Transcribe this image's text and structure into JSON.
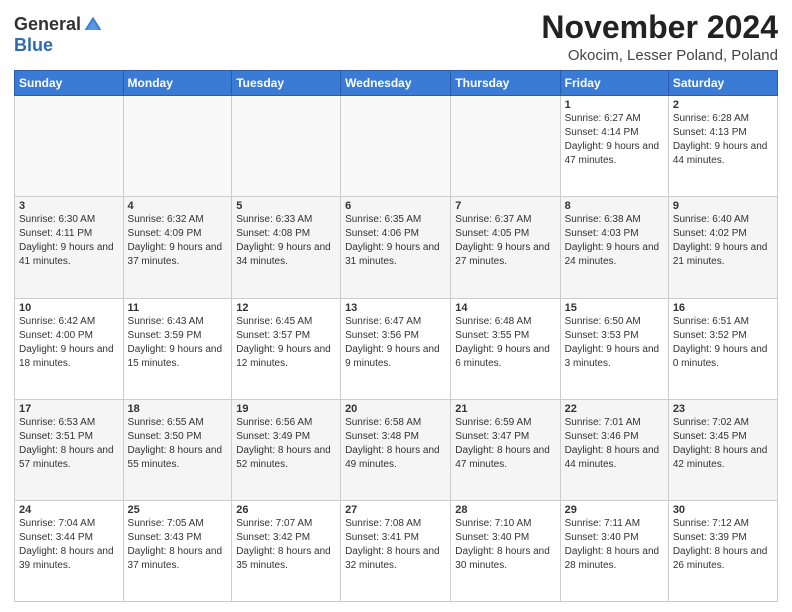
{
  "header": {
    "logo_general": "General",
    "logo_blue": "Blue",
    "month_title": "November 2024",
    "location": "Okocim, Lesser Poland, Poland"
  },
  "days_of_week": [
    "Sunday",
    "Monday",
    "Tuesday",
    "Wednesday",
    "Thursday",
    "Friday",
    "Saturday"
  ],
  "weeks": [
    [
      {
        "day": "",
        "info": ""
      },
      {
        "day": "",
        "info": ""
      },
      {
        "day": "",
        "info": ""
      },
      {
        "day": "",
        "info": ""
      },
      {
        "day": "",
        "info": ""
      },
      {
        "day": "1",
        "info": "Sunrise: 6:27 AM\nSunset: 4:14 PM\nDaylight: 9 hours and 47 minutes."
      },
      {
        "day": "2",
        "info": "Sunrise: 6:28 AM\nSunset: 4:13 PM\nDaylight: 9 hours and 44 minutes."
      }
    ],
    [
      {
        "day": "3",
        "info": "Sunrise: 6:30 AM\nSunset: 4:11 PM\nDaylight: 9 hours and 41 minutes."
      },
      {
        "day": "4",
        "info": "Sunrise: 6:32 AM\nSunset: 4:09 PM\nDaylight: 9 hours and 37 minutes."
      },
      {
        "day": "5",
        "info": "Sunrise: 6:33 AM\nSunset: 4:08 PM\nDaylight: 9 hours and 34 minutes."
      },
      {
        "day": "6",
        "info": "Sunrise: 6:35 AM\nSunset: 4:06 PM\nDaylight: 9 hours and 31 minutes."
      },
      {
        "day": "7",
        "info": "Sunrise: 6:37 AM\nSunset: 4:05 PM\nDaylight: 9 hours and 27 minutes."
      },
      {
        "day": "8",
        "info": "Sunrise: 6:38 AM\nSunset: 4:03 PM\nDaylight: 9 hours and 24 minutes."
      },
      {
        "day": "9",
        "info": "Sunrise: 6:40 AM\nSunset: 4:02 PM\nDaylight: 9 hours and 21 minutes."
      }
    ],
    [
      {
        "day": "10",
        "info": "Sunrise: 6:42 AM\nSunset: 4:00 PM\nDaylight: 9 hours and 18 minutes."
      },
      {
        "day": "11",
        "info": "Sunrise: 6:43 AM\nSunset: 3:59 PM\nDaylight: 9 hours and 15 minutes."
      },
      {
        "day": "12",
        "info": "Sunrise: 6:45 AM\nSunset: 3:57 PM\nDaylight: 9 hours and 12 minutes."
      },
      {
        "day": "13",
        "info": "Sunrise: 6:47 AM\nSunset: 3:56 PM\nDaylight: 9 hours and 9 minutes."
      },
      {
        "day": "14",
        "info": "Sunrise: 6:48 AM\nSunset: 3:55 PM\nDaylight: 9 hours and 6 minutes."
      },
      {
        "day": "15",
        "info": "Sunrise: 6:50 AM\nSunset: 3:53 PM\nDaylight: 9 hours and 3 minutes."
      },
      {
        "day": "16",
        "info": "Sunrise: 6:51 AM\nSunset: 3:52 PM\nDaylight: 9 hours and 0 minutes."
      }
    ],
    [
      {
        "day": "17",
        "info": "Sunrise: 6:53 AM\nSunset: 3:51 PM\nDaylight: 8 hours and 57 minutes."
      },
      {
        "day": "18",
        "info": "Sunrise: 6:55 AM\nSunset: 3:50 PM\nDaylight: 8 hours and 55 minutes."
      },
      {
        "day": "19",
        "info": "Sunrise: 6:56 AM\nSunset: 3:49 PM\nDaylight: 8 hours and 52 minutes."
      },
      {
        "day": "20",
        "info": "Sunrise: 6:58 AM\nSunset: 3:48 PM\nDaylight: 8 hours and 49 minutes."
      },
      {
        "day": "21",
        "info": "Sunrise: 6:59 AM\nSunset: 3:47 PM\nDaylight: 8 hours and 47 minutes."
      },
      {
        "day": "22",
        "info": "Sunrise: 7:01 AM\nSunset: 3:46 PM\nDaylight: 8 hours and 44 minutes."
      },
      {
        "day": "23",
        "info": "Sunrise: 7:02 AM\nSunset: 3:45 PM\nDaylight: 8 hours and 42 minutes."
      }
    ],
    [
      {
        "day": "24",
        "info": "Sunrise: 7:04 AM\nSunset: 3:44 PM\nDaylight: 8 hours and 39 minutes."
      },
      {
        "day": "25",
        "info": "Sunrise: 7:05 AM\nSunset: 3:43 PM\nDaylight: 8 hours and 37 minutes."
      },
      {
        "day": "26",
        "info": "Sunrise: 7:07 AM\nSunset: 3:42 PM\nDaylight: 8 hours and 35 minutes."
      },
      {
        "day": "27",
        "info": "Sunrise: 7:08 AM\nSunset: 3:41 PM\nDaylight: 8 hours and 32 minutes."
      },
      {
        "day": "28",
        "info": "Sunrise: 7:10 AM\nSunset: 3:40 PM\nDaylight: 8 hours and 30 minutes."
      },
      {
        "day": "29",
        "info": "Sunrise: 7:11 AM\nSunset: 3:40 PM\nDaylight: 8 hours and 28 minutes."
      },
      {
        "day": "30",
        "info": "Sunrise: 7:12 AM\nSunset: 3:39 PM\nDaylight: 8 hours and 26 minutes."
      }
    ]
  ]
}
